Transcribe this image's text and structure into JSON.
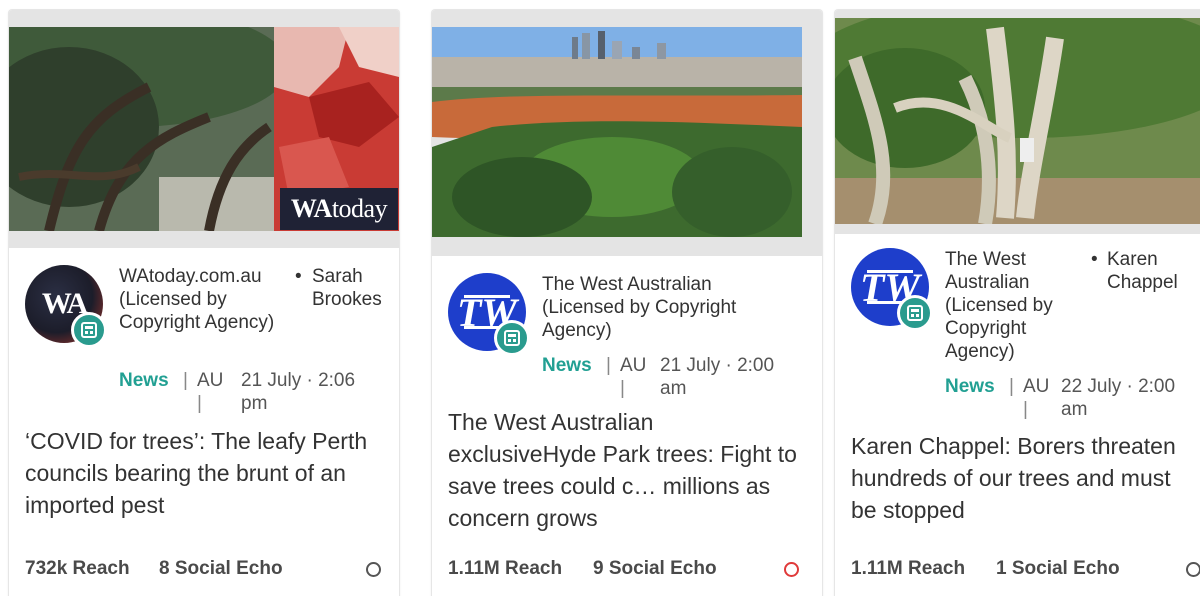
{
  "cards": [
    {
      "outlet": "WAtoday.com.au (Licensed by Copyright Agency)",
      "author": "Sarah Brookes",
      "type": "News",
      "country": "AU",
      "date": "21 July · 2:06 pm",
      "headline": "‘COVID for trees’: The leafy Perth councils bearing the brunt of an imported pest",
      "reach": "732k Reach",
      "social_echo": "8 Social Echo",
      "logo_text": "WA",
      "watermark": {
        "bold": "WA",
        "light": "today"
      },
      "status_color": "#555555"
    },
    {
      "outlet": "The West Australian (Licensed by Copyright Agency)",
      "author": "",
      "type": "News",
      "country": "AU",
      "date": "21 July · 2:00 am",
      "headline": "The West Australian exclusiveHyde Park trees: Fight to save trees could c… millions as concern grows",
      "reach": "1.11M Reach",
      "social_echo": "9 Social Echo",
      "logo_text": "TW",
      "status_color": "#e03a3a"
    },
    {
      "outlet": "The West Australian (Licensed by Copyright Agency)",
      "author": "Karen Chappel",
      "type": "News",
      "country": "AU",
      "date": "22 July · 2:00 am",
      "headline": "Karen Chappel: Borers threaten hundreds of our trees and must be stopped",
      "reach": "1.11M Reach",
      "social_echo": "1 Social Echo",
      "logo_text": "TW",
      "status_color": "#555555"
    }
  ],
  "separators": {
    "dot": "•",
    "pipe": "|"
  },
  "accent_color": "#22a093"
}
